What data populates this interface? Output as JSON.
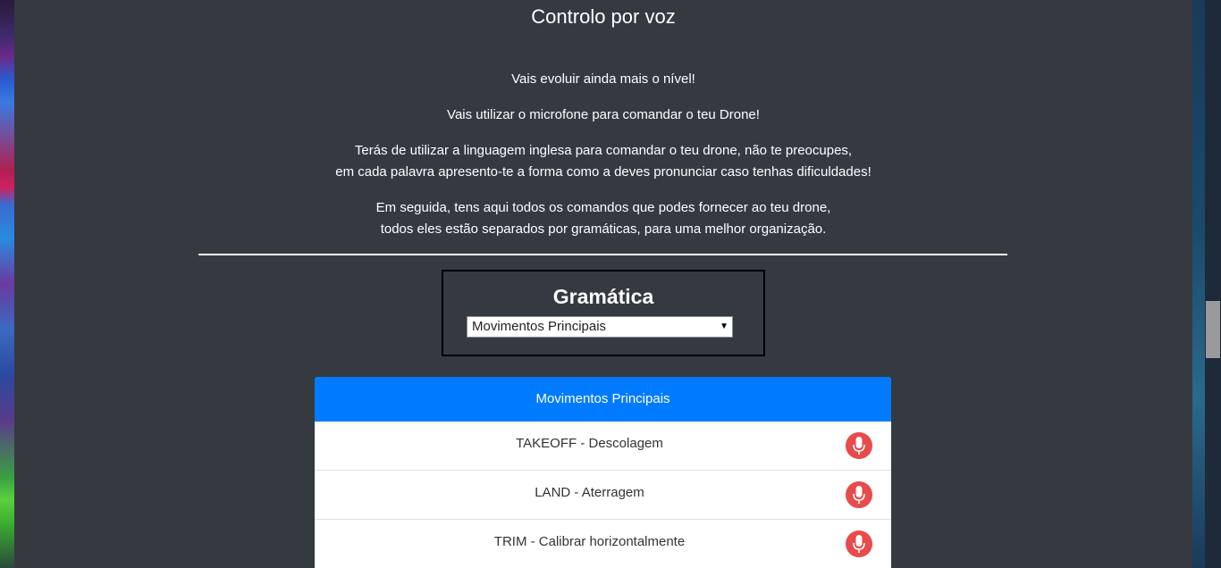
{
  "page": {
    "title": "Controlo por voz",
    "intro": [
      "Vais evoluir ainda mais o nível!",
      "Vais utilizar o microfone para comandar o teu Drone!",
      "Terás de utilizar a linguagem inglesa para comandar o teu drone, não te preocupes,",
      "em cada palavra apresento-te a forma como a deves pronunciar caso tenhas dificuldades!",
      "Em seguida, tens aqui todos os comandos que podes fornecer ao teu drone,",
      "todos eles estão separados por gramáticas, para uma melhor organização."
    ]
  },
  "grammar": {
    "title": "Gramática",
    "selected": "Movimentos Principais"
  },
  "card": {
    "header": "Movimentos Principais",
    "commands": [
      {
        "label": "TAKEOFF - Descolagem",
        "icon": "microphone-icon"
      },
      {
        "label": "LAND - Aterragem",
        "icon": "microphone-icon"
      },
      {
        "label": "TRIM - Calibrar horizontalmente",
        "icon": "microphone-icon"
      }
    ]
  },
  "colors": {
    "background": "#343a40",
    "accent": "#007bff",
    "mic": "#e84b4b"
  }
}
